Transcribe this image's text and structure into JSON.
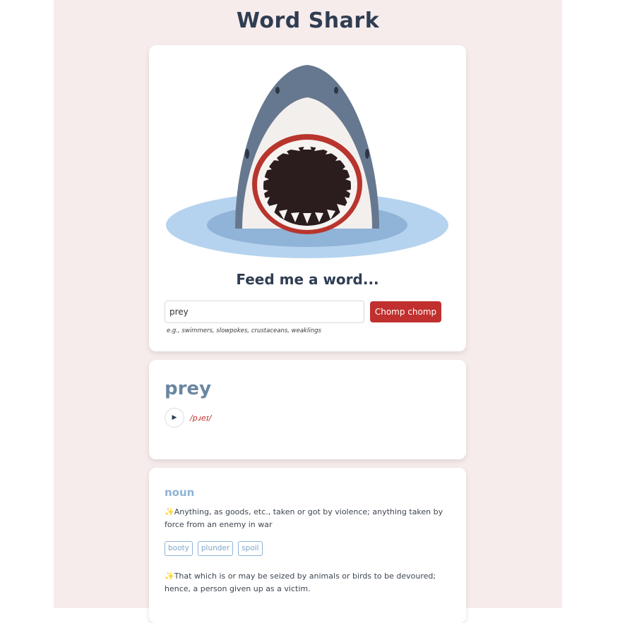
{
  "app": {
    "title": "Word Shark"
  },
  "hero": {
    "prompt": "Feed me a word...",
    "input_value": "prey",
    "button_label": "Chomp chomp",
    "hint": "e.g., swimmers, slowpokes, crustaceans, weaklings"
  },
  "word": {
    "text": "prey",
    "play_icon": "▶",
    "phonetic": "/pɹeɪ/"
  },
  "meanings": {
    "part_of_speech": "noun",
    "definitions": [
      "✨Anything, as goods, etc., taken or got by violence; anything taken by force from an enemy in war",
      "✨That which is or may be seized by animals or birds to be devoured; hence, a person given up as a victim."
    ],
    "synonyms": [
      "booty",
      "plunder",
      "spoil"
    ]
  },
  "colors": {
    "background": "#f7ecec",
    "accent": "#c0302f",
    "shark_body": "#66788f",
    "water": "#b5d3ee",
    "muted_blue": "#8fb3d6"
  }
}
